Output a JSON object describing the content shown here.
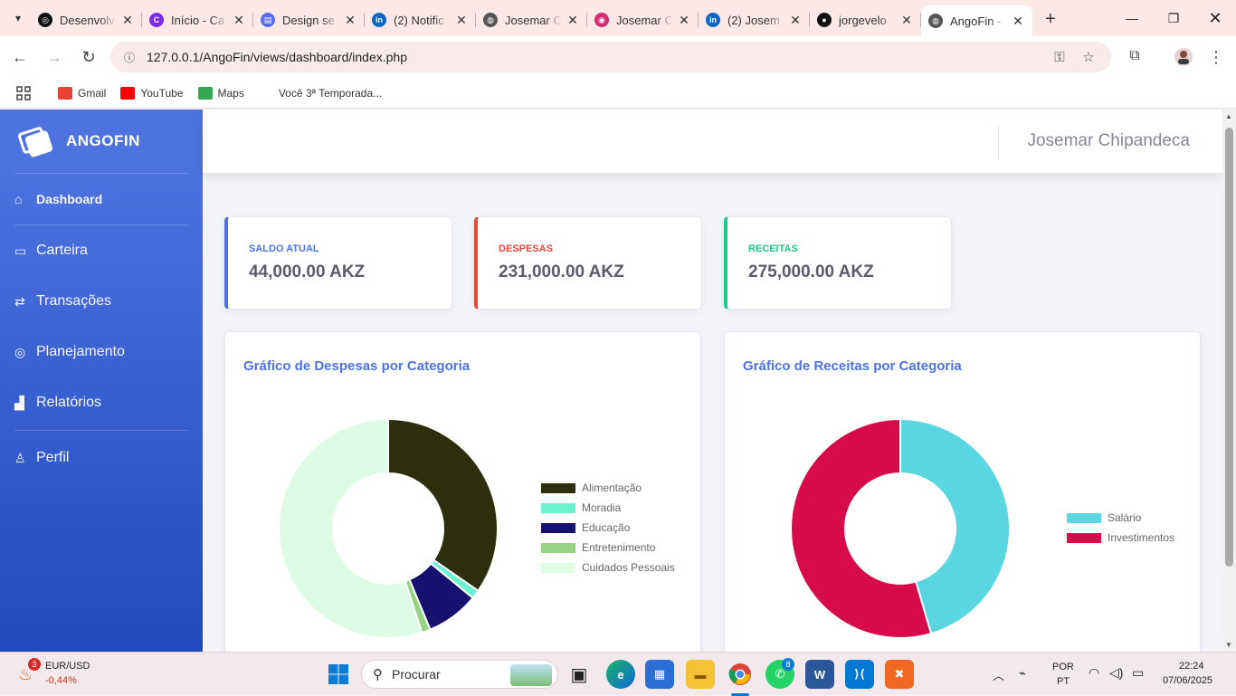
{
  "browser": {
    "tabs": [
      {
        "title": "Desenvolv",
        "icon": "openai-icon",
        "color": "#111111",
        "glyph": "◎"
      },
      {
        "title": "Início - Ca",
        "icon": "canva-icon",
        "color": "#7d2ae8",
        "glyph": "C"
      },
      {
        "title": "Design se",
        "icon": "design-icon",
        "color": "#5b6cf0",
        "glyph": "▤"
      },
      {
        "title": "(2) Notific",
        "icon": "linkedin-icon",
        "color": "#0a66c2",
        "glyph": "in"
      },
      {
        "title": "Josemar C",
        "icon": "globe-icon",
        "color": "#555555",
        "glyph": "◍"
      },
      {
        "title": "Josemar C",
        "icon": "instagram-icon",
        "color": "#d62976",
        "glyph": "◉"
      },
      {
        "title": "(2) Josem",
        "icon": "linkedin-icon",
        "color": "#0a66c2",
        "glyph": "in"
      },
      {
        "title": "jorgevelo",
        "icon": "github-icon",
        "color": "#111111",
        "glyph": "●"
      },
      {
        "title": "AngoFin -",
        "icon": "globe-icon",
        "color": "#555555",
        "glyph": "◍",
        "active": true
      }
    ],
    "url": "127.0.0.1/AngoFin/views/dashboard/index.php",
    "bookmarks": [
      {
        "label": "Gmail",
        "icon": "gmail-icon",
        "color": "#ea4335"
      },
      {
        "label": "YouTube",
        "icon": "youtube-icon",
        "color": "#ff0000"
      },
      {
        "label": "Maps",
        "icon": "maps-icon",
        "color": "#34a853"
      },
      {
        "label": "Você 3ª Temporada...",
        "icon": "page-icon",
        "color": "#ffffff"
      }
    ]
  },
  "app": {
    "brand": "ANGOFIN",
    "nav": [
      {
        "label": "Dashboard",
        "icon": "home-icon",
        "glyph": "⌂",
        "active": true
      },
      {
        "label": "Carteira",
        "icon": "wallet-icon",
        "glyph": "▭"
      },
      {
        "label": "Transações",
        "icon": "exchange-icon",
        "glyph": "⇄"
      },
      {
        "label": "Planejamento",
        "icon": "target-icon",
        "glyph": "◎"
      },
      {
        "label": "Relatórios",
        "icon": "bar-chart-icon",
        "glyph": "▟"
      },
      {
        "label": "Perfil",
        "icon": "user-icon",
        "glyph": "♙"
      }
    ],
    "user_name": "Josemar Chipandeca",
    "stats": [
      {
        "label": "SALDO ATUAL",
        "value": "44,000.00 AKZ",
        "color": "#4e73df"
      },
      {
        "label": "DESPESAS",
        "value": "231,000.00 AKZ",
        "color": "#e74a3b"
      },
      {
        "label": "RECEITAS",
        "value": "275,000.00 AKZ",
        "color": "#1cc88a"
      }
    ]
  },
  "chart_data": [
    {
      "type": "pie",
      "title": "Gráfico de Despesas por Categoria",
      "categories": [
        "Alimentação",
        "Moradia",
        "Educação",
        "Entretenimento",
        "Cuidados Pessoais"
      ],
      "values": [
        80000,
        3000,
        18000,
        3000,
        127000
      ],
      "colors": [
        "#2d2e0c",
        "#6af2cf",
        "#16106e",
        "#96d484",
        "#defce4"
      ],
      "legend": "right"
    },
    {
      "type": "pie",
      "title": "Gráfico de Receitas por Categoria",
      "categories": [
        "Salário",
        "Investimentos"
      ],
      "values": [
        125000,
        150000
      ],
      "colors": [
        "#5ad6e0",
        "#d70a4b"
      ],
      "legend": "right"
    }
  ],
  "taskbar": {
    "currency_pair": "EUR/USD",
    "currency_change": "-0,44%",
    "currency_badge": "3",
    "search_placeholder": "Procurar",
    "whatsapp_badge": "8",
    "lang_line1": "POR",
    "lang_line2": "PT",
    "time": "22:24",
    "date": "07/06/2025"
  }
}
